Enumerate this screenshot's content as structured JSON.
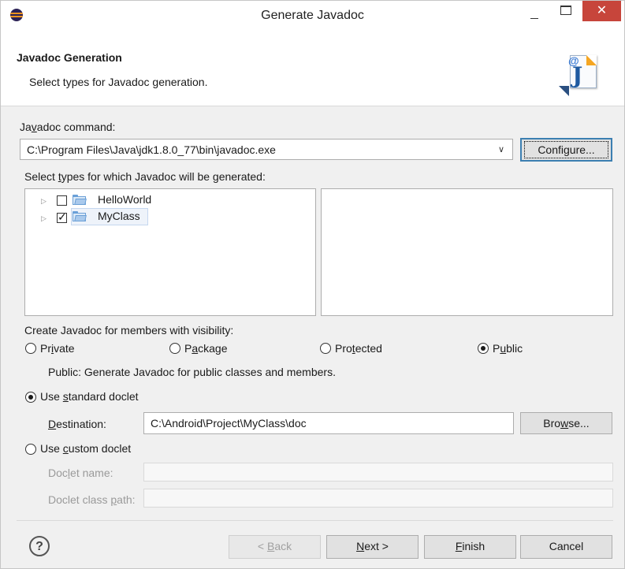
{
  "window": {
    "title": "Generate Javadoc",
    "controls": {
      "minimize": "–",
      "maximize": "□",
      "close": "✕"
    }
  },
  "header": {
    "title": "Javadoc Generation",
    "subtitle": "Select types for Javadoc generation."
  },
  "javadoc_command": {
    "label": "Javadoc command:",
    "value": "C:\\Program Files\\Java\\jdk1.8.0_77\\bin\\javadoc.exe",
    "configure_label": "Configure..."
  },
  "types": {
    "label": "Select types for which Javadoc will be generated:",
    "items": [
      {
        "label": "HelloWorld",
        "checked": false
      },
      {
        "label": "MyClass",
        "checked": true
      }
    ]
  },
  "visibility": {
    "label": "Create Javadoc for members with visibility:",
    "options": [
      "Private",
      "Package",
      "Protected",
      "Public"
    ],
    "selected": "Public",
    "description": "Public: Generate Javadoc for public classes and members."
  },
  "standard_doclet": {
    "label": "Use standard doclet",
    "selected": true,
    "destination_label": "Destination:",
    "destination_value": "C:\\Android\\Project\\MyClass\\doc",
    "browse_label": "Browse..."
  },
  "custom_doclet": {
    "label": "Use custom doclet",
    "selected": false,
    "name_label": "Doclet name:",
    "path_label": "Doclet class path:",
    "name_value": "",
    "path_value": ""
  },
  "footer": {
    "help": "?",
    "back_label": "< Back",
    "next_label": "Next >",
    "finish_label": "Finish",
    "cancel_label": "Cancel"
  }
}
